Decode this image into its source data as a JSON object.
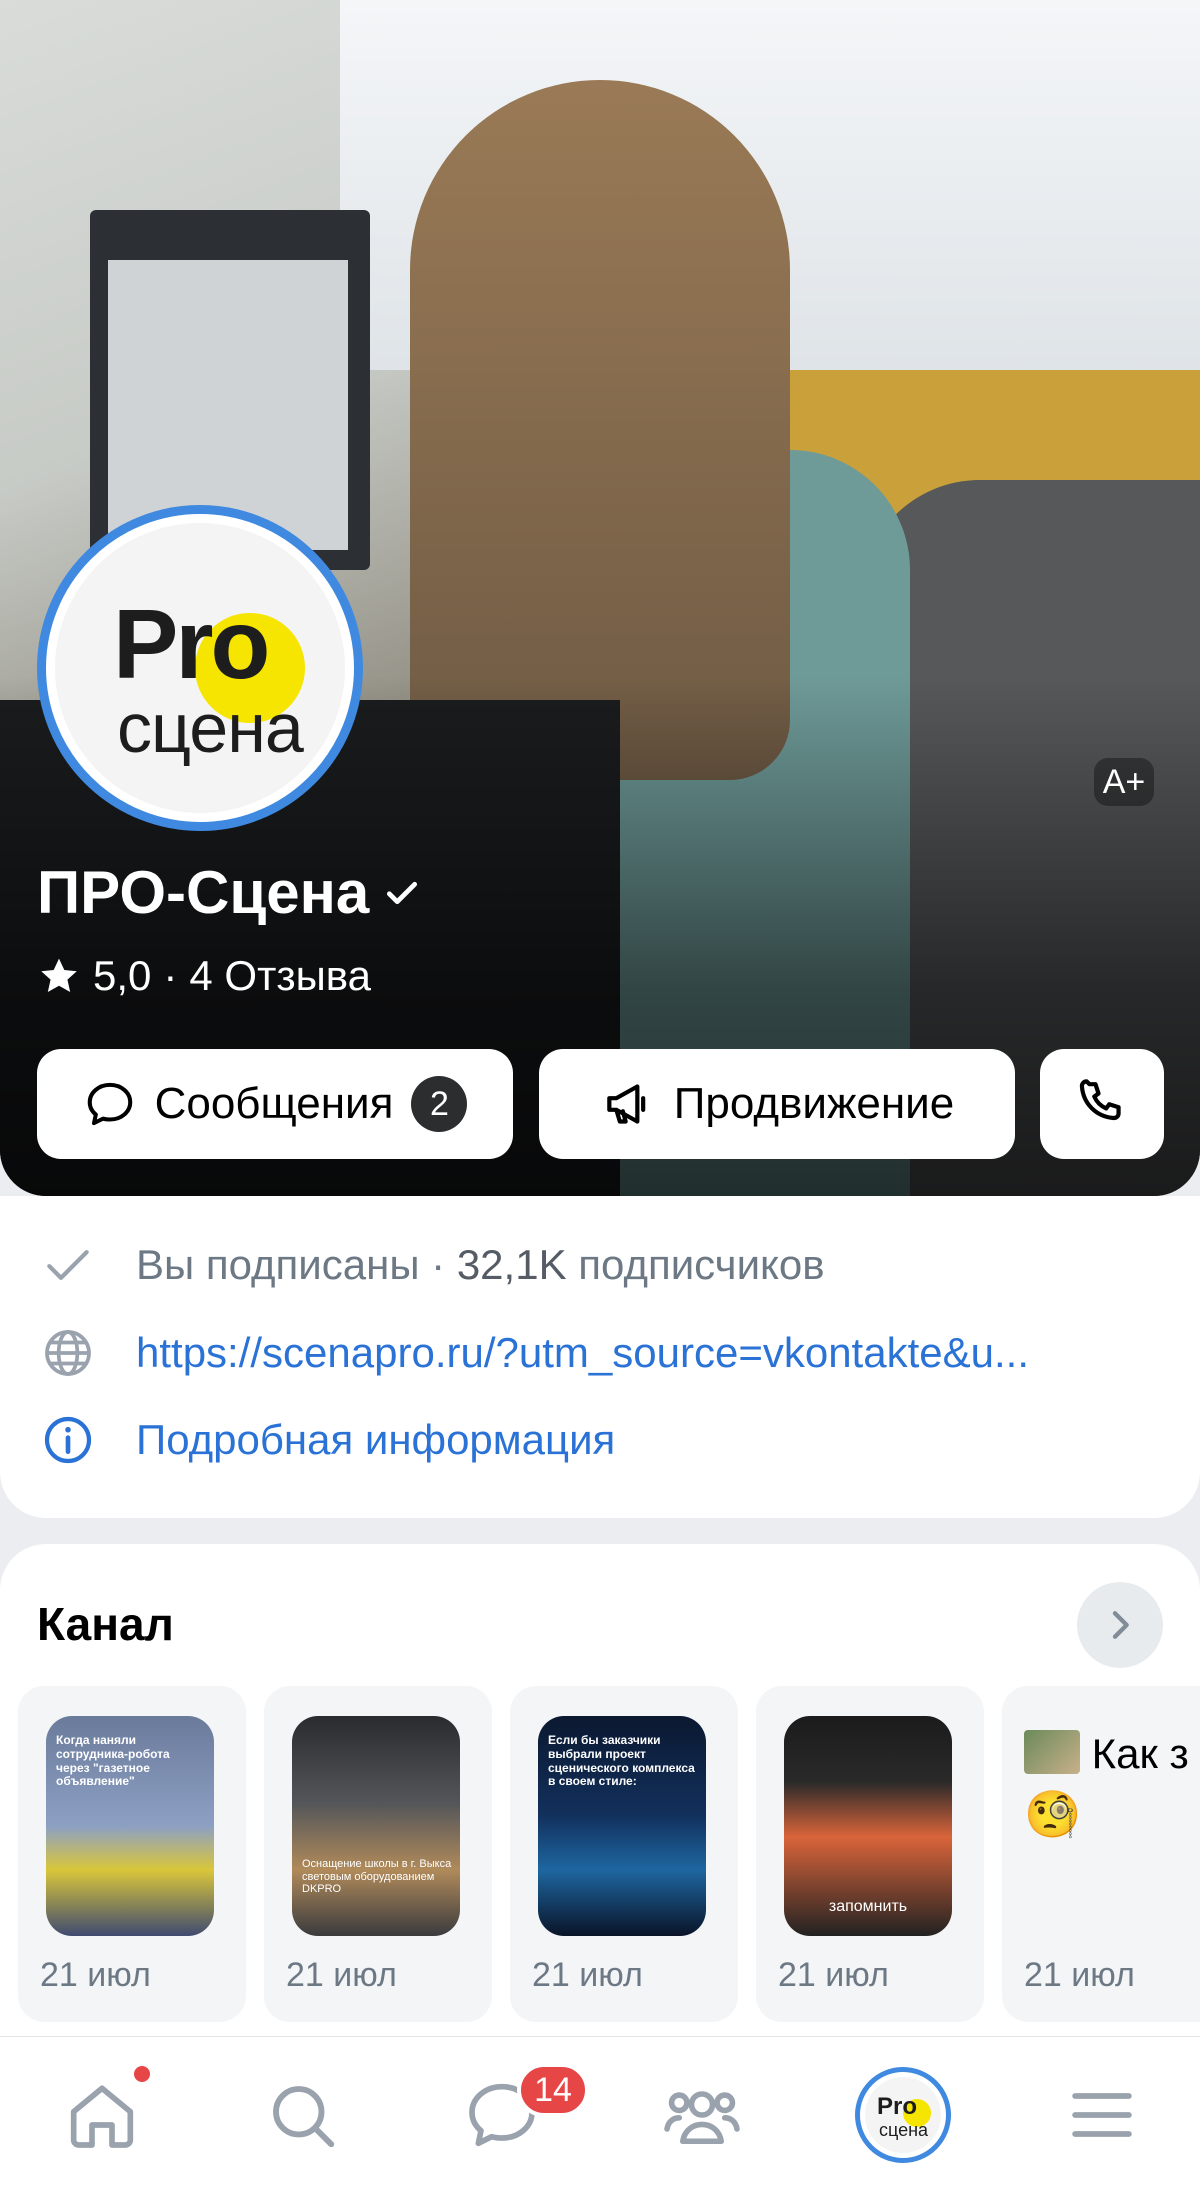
{
  "hero": {
    "aplus": "A+",
    "group_name": "ПРО-Сцена",
    "rating_value": "5,0",
    "rating_sep": "·",
    "reviews": "4 Отзыва",
    "avatar": {
      "line1": "Pro",
      "line2": "сцена"
    }
  },
  "actions": {
    "messages_label": "Сообщения",
    "messages_count": "2",
    "promo_label": "Продвижение"
  },
  "info": {
    "subscribed": "Вы подписаны ·",
    "subscribers": "32,1K",
    "subscribers_suffix": "подписчиков",
    "link": "https://scenapro.ru/?utm_source=vkontakte&u...",
    "details": "Подробная информация"
  },
  "channel": {
    "title": "Канал",
    "items": [
      {
        "date": "21 июл",
        "caption": "Когда наняли сотрудника-робота через \"газетное объявление\""
      },
      {
        "date": "21 июл",
        "caption": "Оснащение школы в г. Выкса световым оборудованием DKPRO"
      },
      {
        "date": "21 июл",
        "caption": "Если бы заказчики выбрали проект сценического комплекса в своем стиле:"
      },
      {
        "date": "21 июл",
        "caption": "запомнить"
      },
      {
        "date": "21 июл",
        "text": "Как з сцениче"
      }
    ]
  },
  "nav": {
    "messages_badge": "14",
    "avatar_line1": "Pro",
    "avatar_line2": "сцена"
  },
  "colors": {
    "accent": "#3f8ae0",
    "link": "#2a72d6",
    "badge": "#e64646",
    "avatar_yellow": "#f5e500"
  }
}
